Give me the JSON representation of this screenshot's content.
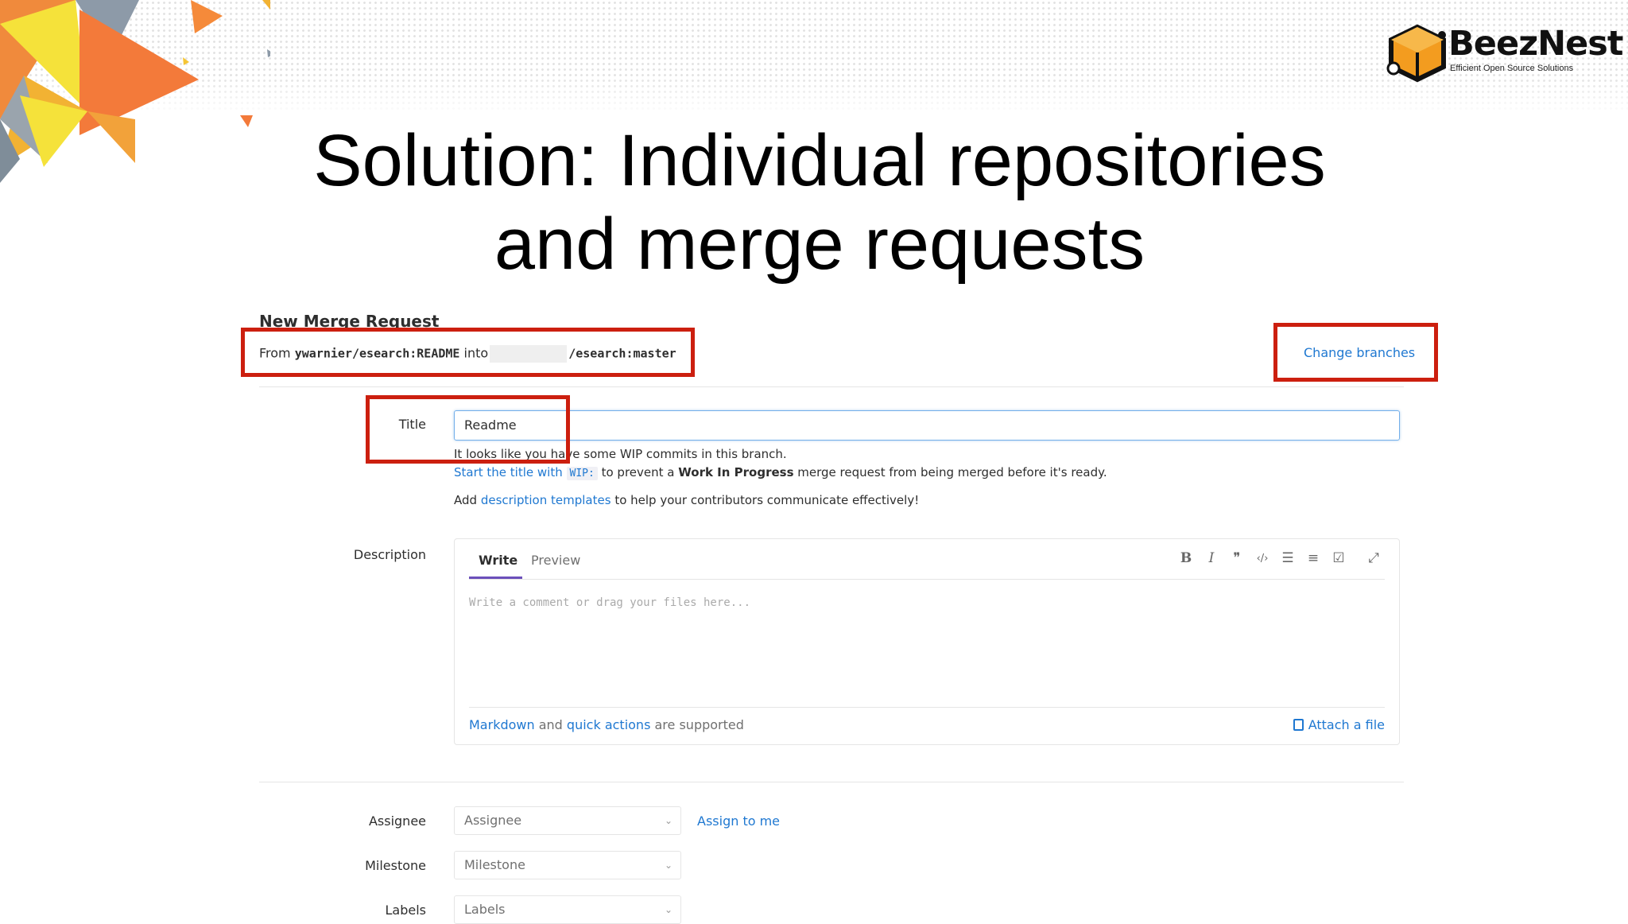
{
  "slide": {
    "title_line1": "Solution: Individual repositories",
    "title_line2": "and merge requests"
  },
  "logo": {
    "name": "BeezNest",
    "tagline": "Efficient Open Source Solutions",
    "icon": "hexagon-logo-icon"
  },
  "merge_request": {
    "heading": "New Merge Request",
    "from_prefix": "From",
    "source_branch": "ywarnier/esearch:README",
    "into_word": "into",
    "target_branch": "/esearch:master",
    "change_branches": "Change branches"
  },
  "title_field": {
    "label": "Title",
    "value": "Readme",
    "wip_notice": "It looks like you have some WIP commits in this branch.",
    "wip_link": "Start the title with",
    "wip_code": "WIP:",
    "wip_middle": "to prevent a",
    "wip_bold": "Work In Progress",
    "wip_end": "merge request from being merged before it's ready.",
    "templates_prefix": "Add",
    "templates_link": "description templates",
    "templates_suffix": "to help your contributors communicate effectively!"
  },
  "description": {
    "label": "Description",
    "tab_write": "Write",
    "tab_preview": "Preview",
    "toolbar": {
      "bold": "B",
      "italic": "I",
      "quote": "❞",
      "code": "‹/›",
      "bullet_list": "☰",
      "numbered_list": "≡",
      "task_list": "☑",
      "fullscreen": "⤢"
    },
    "placeholder": "Write a comment or drag your files here...",
    "footer_markdown": "Markdown",
    "footer_and": "and",
    "footer_quick_actions": "quick actions",
    "footer_supported": "are supported",
    "attach_label": "Attach a file"
  },
  "assignee": {
    "label": "Assignee",
    "value": "Assignee",
    "assign_to_me": "Assign to me"
  },
  "milestone": {
    "label": "Milestone",
    "value": "Milestone"
  },
  "labels": {
    "label": "Labels",
    "value": "Labels"
  },
  "colors": {
    "link": "#1f78d1",
    "highlight_box": "#cc1f0f",
    "active_tab": "#6b4fbb",
    "logo_orange": "#f39c1f"
  }
}
